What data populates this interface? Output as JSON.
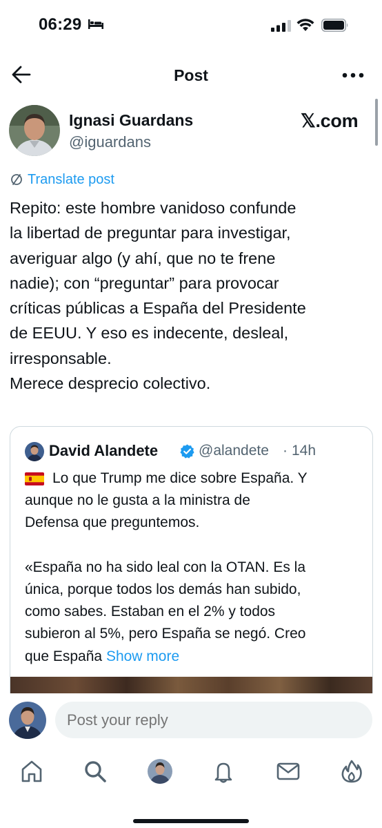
{
  "status_bar": {
    "time": "06:29"
  },
  "nav": {
    "title": "Post"
  },
  "author": {
    "name": "Ignasi Guardans",
    "handle": "@iguardans",
    "source": "𝕏.com"
  },
  "translate": {
    "label": "Translate post"
  },
  "post": {
    "lines": [
      "Repito: este hombre vanidoso confunde",
      "la libertad de preguntar para investigar,",
      "averiguar algo (y ahí, que no te frene",
      "nadie); con “preguntar” para provocar",
      "críticas públicas a España del Presidente",
      "de EEUU. Y eso es indecente, desleal,",
      "irresponsable.",
      "Merece desprecio colectivo."
    ]
  },
  "quote": {
    "name": "David Alandete",
    "handle": "@alandete",
    "separator": "·",
    "time": "14h",
    "lines": [
      "Lo que Trump me dice sobre España. Y",
      "aunque no le gusta a la ministra de",
      "Defensa que preguntemos.",
      "",
      "«España no ha sido leal con la OTAN. Es la",
      "única, porque todos los demás han subido,",
      "como sabes. Estaban en el 2% y todos",
      "subieron al 5%, pero España se negó. Creo"
    ],
    "last_line_text": "que España ",
    "show_more": "Show more"
  },
  "reply": {
    "placeholder": "Post your reply"
  },
  "colors": {
    "accent": "#1d9bf0",
    "secondary_text": "#536471",
    "verified": "#1d9bf0"
  },
  "icons": [
    "bed-icon",
    "signal-icon",
    "wifi-icon",
    "battery-icon",
    "back-icon",
    "more-icon",
    "translate-icon",
    "verified-icon",
    "spain-flag-icon",
    "home-icon",
    "search-icon",
    "grok-icon",
    "notifications-icon",
    "messages-icon",
    "fire-icon"
  ]
}
